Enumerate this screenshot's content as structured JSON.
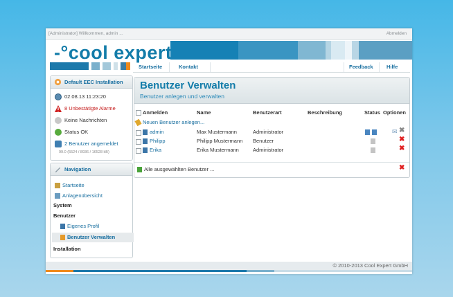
{
  "topbar": {
    "welcome": "[Administrator] Willkommen, admin ...",
    "logout": "Abmelden"
  },
  "logo": {
    "text": "-°cool expert",
    "reg": "®"
  },
  "colors": {
    "brand": "#137ca9",
    "accent_orange": "#f08a1c",
    "danger": "#e02020"
  },
  "nav": {
    "items": [
      "Startseite",
      "Kontakt"
    ],
    "right": [
      "Feedback",
      "Hilfe"
    ]
  },
  "installation": {
    "title": "Default EEC Installation",
    "datetime": "02.08.13 11:23:20",
    "alarms": "8 Unbestätigte Alarme",
    "messages": "Keine Nachrichten",
    "status": "Status OK",
    "users": "2 Benutzer angemeldet",
    "memory": "99.0 (5524 / 8936 / 16528 kB)"
  },
  "navigation": {
    "title": "Navigation",
    "links": [
      "Startseite",
      "Anlagenübersicht"
    ],
    "system": "System",
    "benutzer": "Benutzer",
    "profile": "Eigenes Profil",
    "manage": "Benutzer Verwalten",
    "installation": "Installation"
  },
  "main": {
    "title": "Benutzer Verwalten",
    "subtitle": "Benutzer anlegen und verwalten",
    "columns": [
      "Anmelden",
      "Name",
      "Benutzerart",
      "Beschreibung",
      "Status",
      "Optionen"
    ],
    "new_user": "Neuen Benutzer anlegen...",
    "rows": [
      {
        "login": "admin",
        "name": "Max Mustermann",
        "type": "Administrator",
        "desc": ""
      },
      {
        "login": "Philipp",
        "name": "Philipp Mustermann",
        "type": "Benutzer",
        "desc": ""
      },
      {
        "login": "Erika",
        "name": "Erika Mustermann",
        "type": "Administrator",
        "desc": ""
      }
    ],
    "bulk": "Alle ausgewählten Benutzer ..."
  },
  "footer": {
    "copyright": "© 2010-2013 Cool Expert GmbH"
  }
}
